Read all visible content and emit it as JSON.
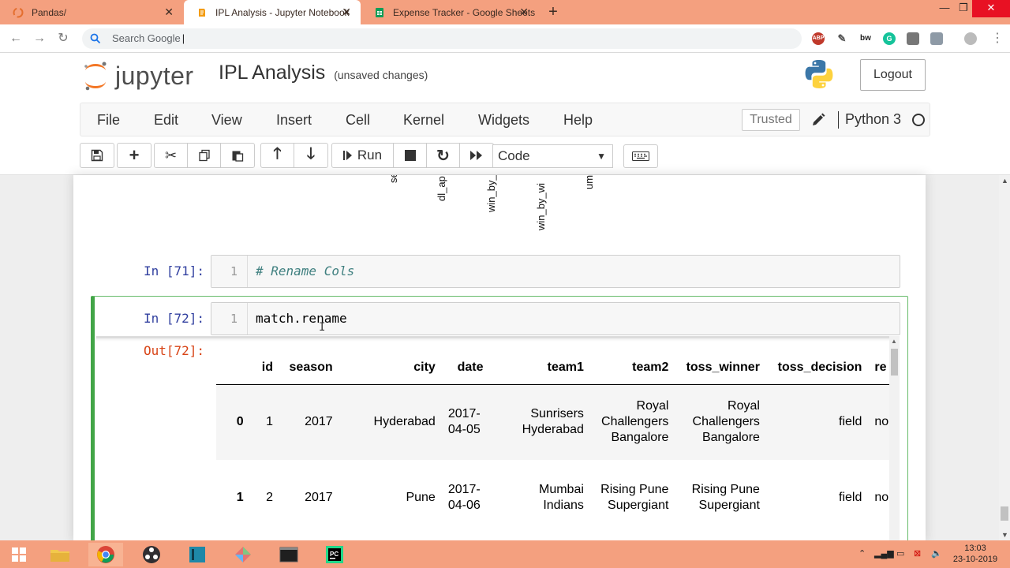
{
  "browser": {
    "tabs": [
      {
        "title": "Pandas/",
        "active": false
      },
      {
        "title": "IPL Analysis - Jupyter Notebook",
        "active": true
      },
      {
        "title": "Expense Tracker - Google Sheets",
        "active": false
      }
    ],
    "new_tab": "+",
    "omnibox_placeholder": "Search Google",
    "caret": "|",
    "extensions": [
      "ABP",
      "dropper",
      "bw",
      "grammarly",
      "screen",
      "reader",
      "profile"
    ]
  },
  "jupyter": {
    "logo_text": "jupyter",
    "notebook_title": "IPL Analysis",
    "save_status": "(unsaved changes)",
    "logout_label": "Logout",
    "menu": [
      "File",
      "Edit",
      "View",
      "Insert",
      "Cell",
      "Kernel",
      "Widgets",
      "Help"
    ],
    "trusted_label": "Trusted",
    "kernel_name": "Python 3",
    "toolbar": {
      "run_label": "Run",
      "cell_type": "Code"
    }
  },
  "notebook": {
    "rotated_headers": [
      "se",
      "dl_ap",
      "win_by_",
      "win_by_wi",
      "um"
    ],
    "cells": [
      {
        "prompt": "In [71]:",
        "line_no": "1",
        "code": "# Rename Cols"
      },
      {
        "prompt": "In [72]:",
        "line_no": "1",
        "code": "match.rename"
      }
    ],
    "output_prompt": "Out[72]:"
  },
  "dataframe": {
    "columns": [
      "",
      "id",
      "season",
      "city",
      "date",
      "team1",
      "team2",
      "toss_winner",
      "toss_decision",
      "re"
    ],
    "rows": [
      {
        "index": "0",
        "id": "1",
        "season": "2017",
        "city": "Hyderabad",
        "date": "2017-04-05",
        "team1": "Sunrisers Hyderabad",
        "team2": "Royal Challengers Bangalore",
        "toss_winner": "Royal Challengers Bangalore",
        "toss_decision": "field",
        "re": "no"
      },
      {
        "index": "1",
        "id": "2",
        "season": "2017",
        "city": "Pune",
        "date": "2017-04-06",
        "team1": "Mumbai Indians",
        "team2": "Rising Pune Supergiant",
        "toss_winner": "Rising Pune Supergiant",
        "toss_decision": "field",
        "re": "no"
      }
    ]
  },
  "taskbar": {
    "time": "13:03",
    "date": "23-10-2019"
  },
  "colors": {
    "chrome_accent": "#f4a07f",
    "selected_cell": "#42a547",
    "in_prompt": "#303f9f",
    "out_prompt": "#d84315"
  }
}
